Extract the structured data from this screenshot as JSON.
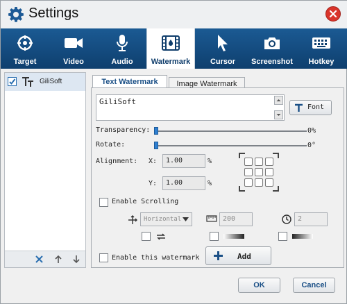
{
  "window": {
    "title": "Settings"
  },
  "tabs": [
    {
      "label": "Target",
      "icon": "target-icon"
    },
    {
      "label": "Video",
      "icon": "video-camera-icon"
    },
    {
      "label": "Audio",
      "icon": "microphone-icon"
    },
    {
      "label": "Watermark",
      "icon": "film-icon",
      "active": true
    },
    {
      "label": "Cursor",
      "icon": "cursor-icon"
    },
    {
      "label": "Screenshot",
      "icon": "camera-icon"
    },
    {
      "label": "Hotkey",
      "icon": "keyboard-icon"
    }
  ],
  "watermark_list": {
    "items": [
      {
        "label": "GiliSoft",
        "checked": true
      }
    ]
  },
  "subtabs": {
    "text": "Text Watermark",
    "image": "Image Watermark"
  },
  "text_watermark": {
    "text_value": "GiliSoft",
    "font_button": "Font",
    "transparency_label": "Transparency:",
    "transparency_value": "0%",
    "transparency_level": 0,
    "rotate_label": "Rotate:",
    "rotate_value": "0°",
    "rotate_level": 0,
    "alignment_label": "Alignment:",
    "x_label": "X:",
    "x_value": "1.00",
    "y_label": "Y:",
    "y_value": "1.00",
    "percent": "%",
    "enable_scrolling_label": "Enable Scrolling",
    "direction_value": "Horizontal",
    "speed_value": "200",
    "count_value": "2",
    "enable_watermark_label": "Enable this watermark",
    "add_button": "Add"
  },
  "footer": {
    "ok": "OK",
    "cancel": "Cancel"
  },
  "colors": {
    "tab_bar": "#1b5a93",
    "accent": "#1a4f86",
    "close": "#d9342b"
  }
}
